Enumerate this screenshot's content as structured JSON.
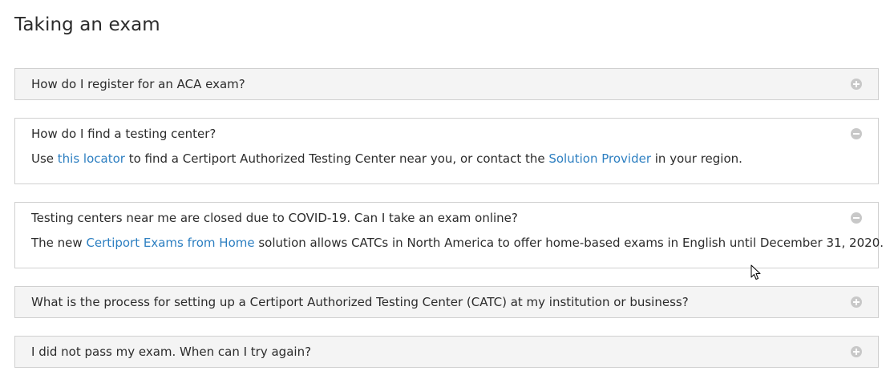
{
  "page": {
    "title": "Taking an exam"
  },
  "faq": [
    {
      "question": "How do I register for an ACA exam?",
      "expanded": false,
      "icon": "plus-circle-icon"
    },
    {
      "question": "How do I find a testing center?",
      "expanded": true,
      "icon": "minus-circle-icon",
      "answer": {
        "prefix": "Use ",
        "link1": "this locator",
        "middle": " to find a Certiport Authorized Testing Center near you, or contact the ",
        "link2": "Solution Provider",
        "suffix": " in your region."
      }
    },
    {
      "question": "Testing centers near me are closed due to COVID-19. Can I take an exam online?",
      "expanded": true,
      "icon": "minus-circle-icon",
      "answer": {
        "prefix": "The new ",
        "link1": "Certiport Exams from Home",
        "suffix": " solution allows CATCs in North America to offer home-based exams in English until December 31, 2020."
      }
    },
    {
      "question": "What is the process for setting up a Certiport Authorized Testing Center (CATC) at my institution or business?",
      "expanded": false,
      "icon": "plus-circle-icon"
    },
    {
      "question": "I did not pass my exam. When can I try again?",
      "expanded": false,
      "icon": "plus-circle-icon"
    }
  ],
  "colors": {
    "link": "#2d7fc1",
    "header_bg": "#f4f4f4",
    "border": "#d0d0d0",
    "icon": "#c8c8c8"
  }
}
